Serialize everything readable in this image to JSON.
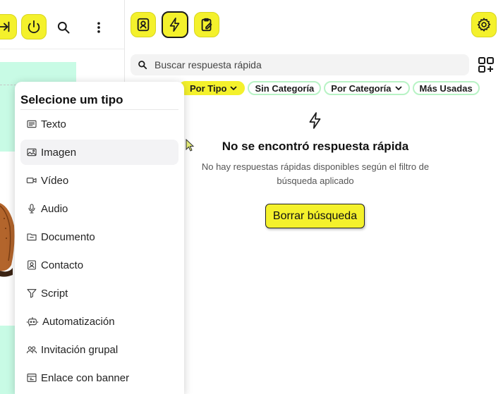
{
  "left_toolbar": {
    "icons": [
      "exit-arrow-icon",
      "power-icon",
      "search-icon",
      "more-vertical-icon"
    ]
  },
  "right_toolbar": {
    "icons": [
      "contact-icon",
      "lightning-icon",
      "clipboard-edit-icon",
      "gear-icon"
    ]
  },
  "search": {
    "placeholder": "Buscar respuesta rápida",
    "value": ""
  },
  "filters": {
    "by_type": "Por Tipo",
    "no_category": "Sin Categoría",
    "by_category": "Por Categoría",
    "most_used": "Más Usadas"
  },
  "empty_state": {
    "title": "No se encontró respuesta rápida",
    "description": "No hay respuestas rápidas disponibles según el filtro de búsqueda aplicado",
    "clear_button": "Borrar búsqueda"
  },
  "type_menu": {
    "title": "Selecione um tipo",
    "items": [
      {
        "label": "Texto",
        "icon": "text-icon"
      },
      {
        "label": "Imagen",
        "icon": "image-icon"
      },
      {
        "label": "Vídeo",
        "icon": "video-icon"
      },
      {
        "label": "Audio",
        "icon": "microphone-icon"
      },
      {
        "label": "Documento",
        "icon": "document-icon"
      },
      {
        "label": "Contacto",
        "icon": "contact-card-icon"
      },
      {
        "label": "Script",
        "icon": "filter-icon"
      },
      {
        "label": "Automatización",
        "icon": "bot-icon"
      },
      {
        "label": "Invitación grupal",
        "icon": "group-icon"
      },
      {
        "label": "Enlace con banner",
        "icon": "banner-link-icon"
      }
    ]
  },
  "colors": {
    "accent_yellow": "#f4f12c",
    "chip_border_green": "#b8f3c5",
    "mint_background": "#c8fbe5"
  }
}
